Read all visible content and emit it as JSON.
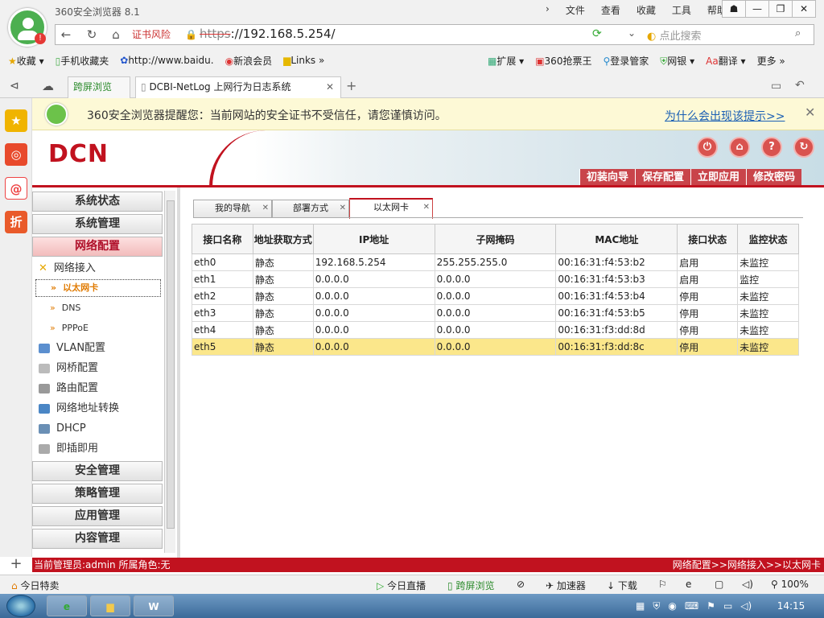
{
  "browser": {
    "title": "360安全浏览器 8.1",
    "menu": [
      "文件",
      "查看",
      "收藏",
      "工具",
      "帮助"
    ],
    "cert_warning": "证书风险",
    "url_scheme": "https",
    "url_rest": "://192.168.5.254/",
    "search_placeholder": "点此搜索",
    "bookmarks": [
      "收藏",
      "手机收藏夹",
      "http://www.baidu.",
      "新浪会员",
      "Links"
    ],
    "bookmarks_right": [
      "扩展",
      "360抢票王",
      "登录管家",
      "网银",
      "翻译",
      "更多"
    ],
    "tabs": [
      "跨屏浏览",
      "DCBI-NetLog 上网行为日志系统"
    ],
    "banner_text": "360安全浏览器提醒您：当前网站的安全证书不受信任，请您谨慎访问。",
    "banner_link": "为什么会出现该提示>>",
    "status_items": [
      "今日特卖",
      "今日直播",
      "跨屏浏览",
      "加速器",
      "下载",
      "100%"
    ],
    "clock": "14:15"
  },
  "app": {
    "logo": "DCN",
    "header_nav": [
      "初装向导",
      "保存配置",
      "立即应用",
      "修改密码"
    ],
    "sidebar": {
      "top_buttons": [
        "系统状态",
        "系统管理",
        "网络配置"
      ],
      "group_label": "网络接入",
      "sub_items": [
        "以太网卡",
        "DNS",
        "PPPoE"
      ],
      "items": [
        "VLAN配置",
        "网桥配置",
        "路由配置",
        "网络地址转换",
        "DHCP",
        "即插即用"
      ],
      "bottom_buttons": [
        "安全管理",
        "策略管理",
        "应用管理",
        "内容管理"
      ]
    },
    "content_tabs": [
      "我的导航",
      "部署方式",
      "以太网卡"
    ],
    "table": {
      "headers": [
        "接口名称",
        "地址获取方式",
        "IP地址",
        "子网掩码",
        "MAC地址",
        "接口状态",
        "监控状态"
      ],
      "rows": [
        [
          "eth0",
          "静态",
          "192.168.5.254",
          "255.255.255.0",
          "00:16:31:f4:53:b2",
          "启用",
          "未监控"
        ],
        [
          "eth1",
          "静态",
          "0.0.0.0",
          "0.0.0.0",
          "00:16:31:f4:53:b3",
          "启用",
          "监控"
        ],
        [
          "eth2",
          "静态",
          "0.0.0.0",
          "0.0.0.0",
          "00:16:31:f4:53:b4",
          "停用",
          "未监控"
        ],
        [
          "eth3",
          "静态",
          "0.0.0.0",
          "0.0.0.0",
          "00:16:31:f4:53:b5",
          "停用",
          "未监控"
        ],
        [
          "eth4",
          "静态",
          "0.0.0.0",
          "0.0.0.0",
          "00:16:31:f3:dd:8d",
          "停用",
          "未监控"
        ],
        [
          "eth5",
          "静态",
          "0.0.0.0",
          "0.0.0.0",
          "00:16:31:f3:dd:8c",
          "停用",
          "未监控"
        ]
      ]
    },
    "status_left": "当前管理员:admin  所属角色:无",
    "status_right": "网络配置>>网络接入>>以太网卡"
  }
}
